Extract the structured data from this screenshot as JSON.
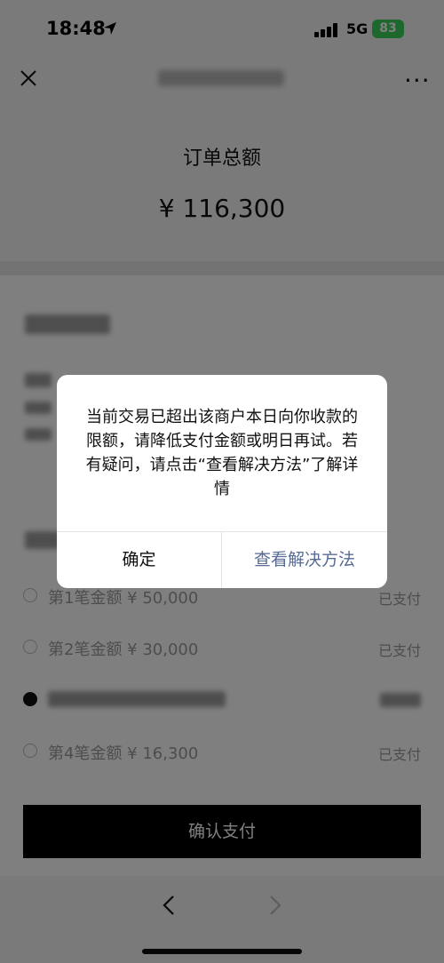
{
  "status_bar": {
    "time": "18:48",
    "network": "5G",
    "battery": "83"
  },
  "nav": {
    "close_icon": "close-icon",
    "more_icon": "more-icon"
  },
  "summary": {
    "label": "订单总额",
    "amount": "¥ 116,300"
  },
  "installments": [
    {
      "label": "第1笔金额 ¥ 50,000",
      "status": "已支付"
    },
    {
      "label": "第2笔金额 ¥ 30,000",
      "status": "已支付"
    },
    {
      "label": "",
      "status": ""
    },
    {
      "label": "第4笔金额 ¥ 16,300",
      "status": "已支付"
    }
  ],
  "pay_button": "确认支付",
  "dialog": {
    "message": "当前交易已超出该商户本日向你收款的限额，请降低支付金额或明日再试。若有疑问，请点击“查看解决方法”了解详情",
    "ok_label": "确定",
    "view_label": "查看解决方法"
  },
  "colors": {
    "link": "#576b95",
    "battery": "#3bd15a"
  }
}
